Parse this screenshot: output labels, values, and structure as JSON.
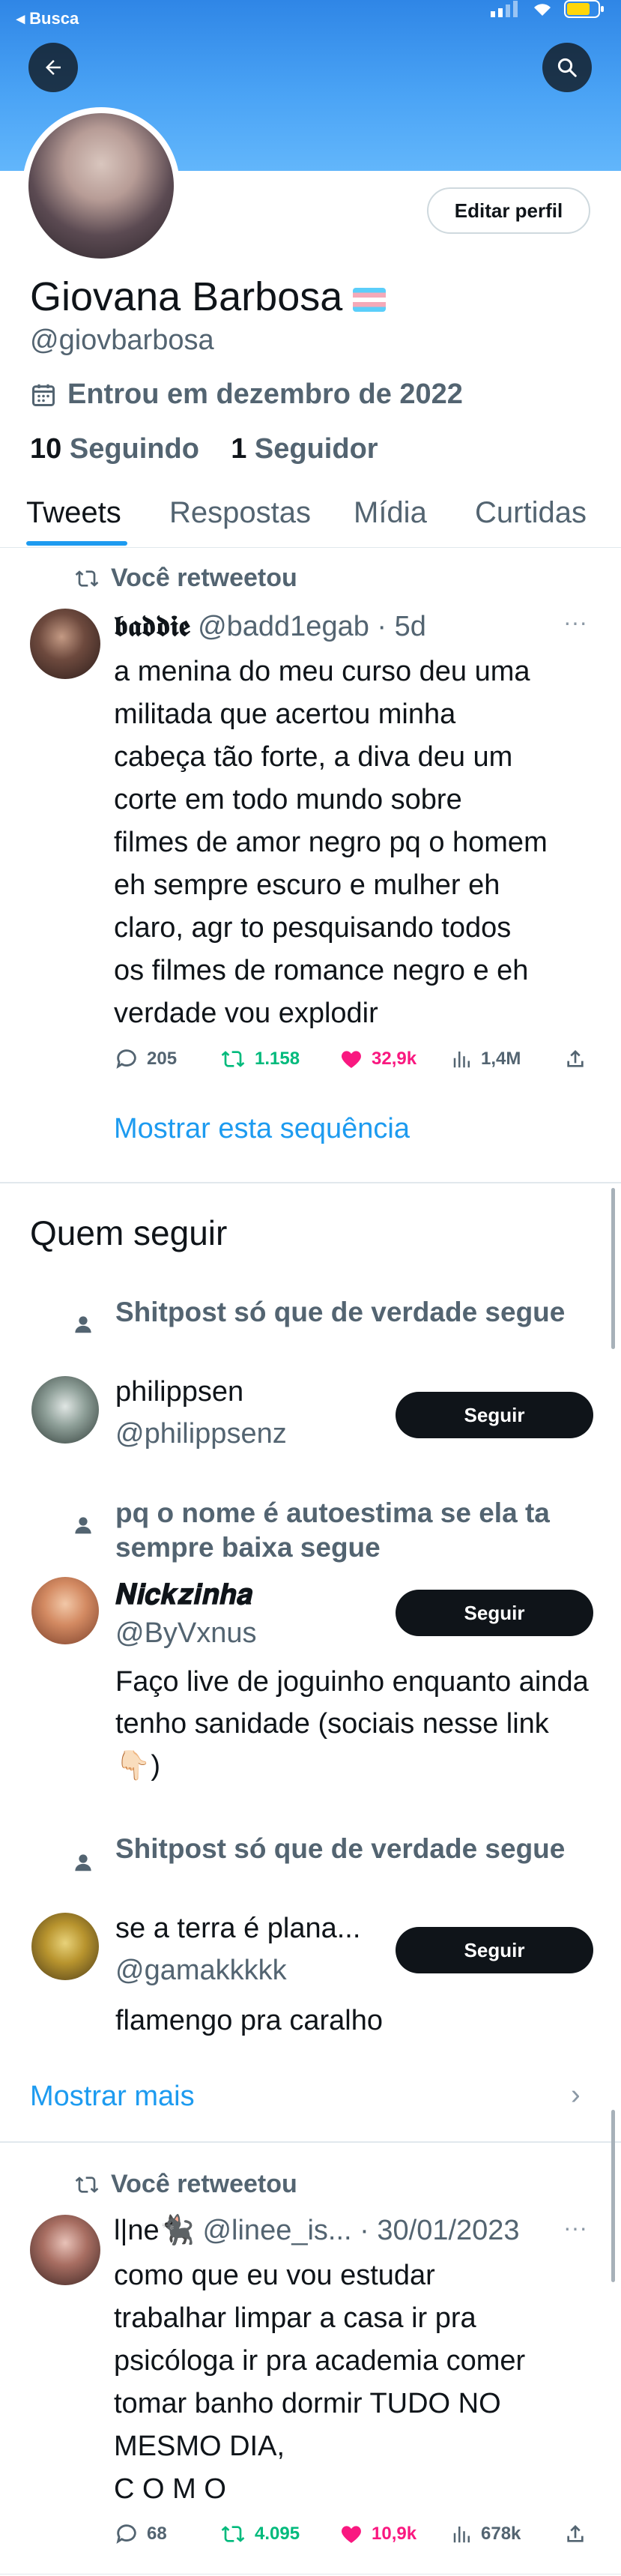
{
  "status_bar": {
    "back_label": "◂ Busca"
  },
  "profile": {
    "name": "Giovana Barbosa",
    "handle": "@giovbarbosa",
    "joined": "Entrou em dezembro de 2022",
    "following_count": "10",
    "following_label": "Seguindo",
    "followers_count": "1",
    "followers_label": "Seguidor",
    "edit_label": "Editar perfil"
  },
  "tabs": [
    {
      "label": "Tweets",
      "active": true
    },
    {
      "label": "Respostas",
      "active": false
    },
    {
      "label": "Mídia",
      "active": false
    },
    {
      "label": "Curtidas",
      "active": false
    }
  ],
  "tweets": [
    {
      "retweet_label": "Você retweetou",
      "display_name": "𝖇𝖆𝖉𝖉𝖎𝖊",
      "handle": "@badd1egab",
      "time": "5d",
      "text_lines": [
        "a menina do meu curso deu uma",
        "militada que acertou minha",
        "cabeça tão forte, a diva deu um",
        "corte em todo mundo sobre",
        "filmes de amor negro pq o homem",
        "eh sempre escuro e mulher eh",
        "claro, agr to pesquisando todos",
        "os filmes de romance negro e eh",
        "verdade vou explodir"
      ],
      "replies": "205",
      "retweets": "1.158",
      "likes": "32,9k",
      "views": "1,4M",
      "show_thread": "Mostrar esta sequência"
    },
    {
      "retweet_label": "Você retweetou",
      "display_name": "l|ne🐈‍⬛",
      "handle": "@linee_is...",
      "time": "30/01/2023",
      "text_lines": [
        "como que eu vou estudar",
        "trabalhar limpar a casa ir pra",
        "psicóloga ir pra academia comer",
        "tomar banho dormir TUDO NO",
        "MESMO DIA,",
        "C O M O"
      ],
      "replies": "68",
      "retweets": "4.095",
      "likes": "10,9k",
      "views": "678k"
    }
  ],
  "who_to_follow": {
    "title": "Quem seguir",
    "follow_label": "Seguir",
    "show_more": "Mostrar mais",
    "suggestions": [
      {
        "context": "Shitpost só que de verdade segue",
        "name": "philippsen",
        "handle": "@philippsenz",
        "bio": ""
      },
      {
        "context": "pq o nome é autoestima se ela ta sempre baixa segue",
        "name": "𝑵𝒊𝒄𝒌𝒛𝒊𝒏𝒉𝒂",
        "handle": "@ByVxnus",
        "bio": "Faço live de joguinho enquanto ainda tenho sanidade (sociais nesse link 👇🏻)"
      },
      {
        "context": "Shitpost só que de verdade segue",
        "name": "se a terra é plana...",
        "handle": "@gamakkkkk",
        "bio": "flamengo pra caralho"
      }
    ]
  },
  "colors": {
    "accent": "#1d9bf0",
    "retweet_green": "#00ba7c",
    "like_pink": "#f91880",
    "banner": "#4aa3f5"
  }
}
